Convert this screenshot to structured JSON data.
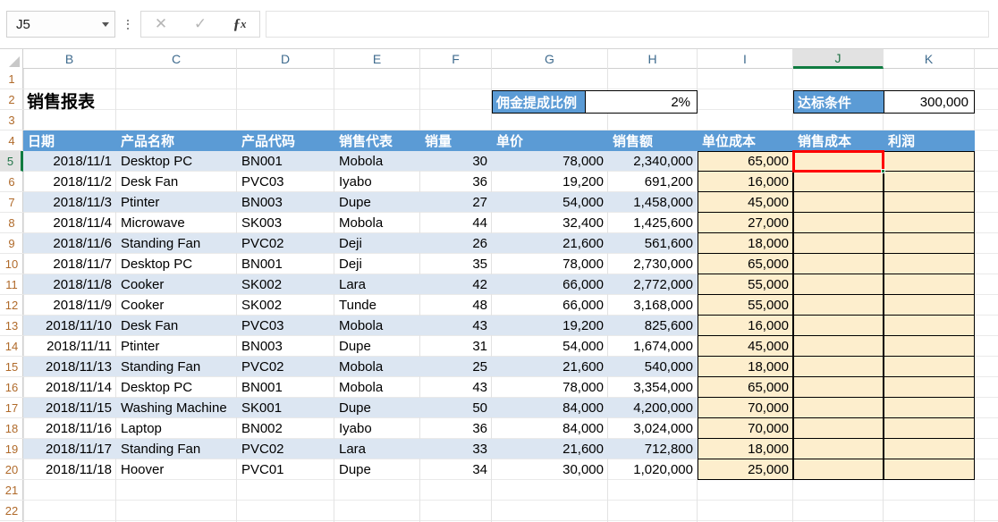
{
  "formula_bar": {
    "name_box_value": "J5",
    "formula_value": "",
    "cancel_icon": "close-x-icon",
    "confirm_icon": "checkmark-icon",
    "function_icon": "fx-insert-function-icon",
    "dropdown_icon": "chevron-down-icon",
    "overflow_icon": "vertical-dots-icon"
  },
  "grid": {
    "columns": [
      "B",
      "C",
      "D",
      "E",
      "F",
      "G",
      "H",
      "I",
      "J",
      "K"
    ],
    "active_column": "J",
    "active_row": "5",
    "rows": [
      "1",
      "2",
      "3",
      "4",
      "5",
      "6",
      "7",
      "8",
      "9",
      "10",
      "11",
      "12",
      "13",
      "14",
      "15",
      "16",
      "17",
      "18",
      "19",
      "20",
      "21",
      "22"
    ]
  },
  "sheet": {
    "title": "销售报表",
    "commission": {
      "label": "佣金提成比例",
      "value": "2%"
    },
    "target": {
      "label": "达标条件",
      "value": "300,000"
    },
    "headers": [
      "日期",
      "产品名称",
      "产品代码",
      "销售代表",
      "销量",
      "单价",
      "销售额",
      "单位成本",
      "销售成本",
      "利润"
    ],
    "rows": [
      {
        "date": "2018/11/1",
        "product": "Desktop PC",
        "code": "BN001",
        "rep": "Mobola",
        "qty": "30",
        "price": "78,000",
        "sales": "2,340,000",
        "unit_cost": "65,000",
        "sales_cost": "",
        "profit": ""
      },
      {
        "date": "2018/11/2",
        "product": "Desk Fan",
        "code": "PVC03",
        "rep": "Iyabo",
        "qty": "36",
        "price": "19,200",
        "sales": "691,200",
        "unit_cost": "16,000",
        "sales_cost": "",
        "profit": ""
      },
      {
        "date": "2018/11/3",
        "product": "Ptinter",
        "code": "BN003",
        "rep": "Dupe",
        "qty": "27",
        "price": "54,000",
        "sales": "1,458,000",
        "unit_cost": "45,000",
        "sales_cost": "",
        "profit": ""
      },
      {
        "date": "2018/11/4",
        "product": "Microwave",
        "code": "SK003",
        "rep": "Mobola",
        "qty": "44",
        "price": "32,400",
        "sales": "1,425,600",
        "unit_cost": "27,000",
        "sales_cost": "",
        "profit": ""
      },
      {
        "date": "2018/11/6",
        "product": "Standing Fan",
        "code": "PVC02",
        "rep": "Deji",
        "qty": "26",
        "price": "21,600",
        "sales": "561,600",
        "unit_cost": "18,000",
        "sales_cost": "",
        "profit": ""
      },
      {
        "date": "2018/11/7",
        "product": "Desktop PC",
        "code": "BN001",
        "rep": "Deji",
        "qty": "35",
        "price": "78,000",
        "sales": "2,730,000",
        "unit_cost": "65,000",
        "sales_cost": "",
        "profit": ""
      },
      {
        "date": "2018/11/8",
        "product": "Cooker",
        "code": "SK002",
        "rep": "Lara",
        "qty": "42",
        "price": "66,000",
        "sales": "2,772,000",
        "unit_cost": "55,000",
        "sales_cost": "",
        "profit": ""
      },
      {
        "date": "2018/11/9",
        "product": "Cooker",
        "code": "SK002",
        "rep": "Tunde",
        "qty": "48",
        "price": "66,000",
        "sales": "3,168,000",
        "unit_cost": "55,000",
        "sales_cost": "",
        "profit": ""
      },
      {
        "date": "2018/11/10",
        "product": "Desk Fan",
        "code": "PVC03",
        "rep": "Mobola",
        "qty": "43",
        "price": "19,200",
        "sales": "825,600",
        "unit_cost": "16,000",
        "sales_cost": "",
        "profit": ""
      },
      {
        "date": "2018/11/11",
        "product": "Ptinter",
        "code": "BN003",
        "rep": "Dupe",
        "qty": "31",
        "price": "54,000",
        "sales": "1,674,000",
        "unit_cost": "45,000",
        "sales_cost": "",
        "profit": ""
      },
      {
        "date": "2018/11/13",
        "product": "Standing Fan",
        "code": "PVC02",
        "rep": "Mobola",
        "qty": "25",
        "price": "21,600",
        "sales": "540,000",
        "unit_cost": "18,000",
        "sales_cost": "",
        "profit": ""
      },
      {
        "date": "2018/11/14",
        "product": "Desktop PC",
        "code": "BN001",
        "rep": "Mobola",
        "qty": "43",
        "price": "78,000",
        "sales": "3,354,000",
        "unit_cost": "65,000",
        "sales_cost": "",
        "profit": ""
      },
      {
        "date": "2018/11/15",
        "product": "Washing Machine",
        "code": "SK001",
        "rep": "Dupe",
        "qty": "50",
        "price": "84,000",
        "sales": "4,200,000",
        "unit_cost": "70,000",
        "sales_cost": "",
        "profit": ""
      },
      {
        "date": "2018/11/16",
        "product": "Laptop",
        "code": "BN002",
        "rep": "Iyabo",
        "qty": "36",
        "price": "84,000",
        "sales": "3,024,000",
        "unit_cost": "70,000",
        "sales_cost": "",
        "profit": ""
      },
      {
        "date": "2018/11/17",
        "product": "Standing Fan",
        "code": "PVC02",
        "rep": "Lara",
        "qty": "33",
        "price": "21,600",
        "sales": "712,800",
        "unit_cost": "18,000",
        "sales_cost": "",
        "profit": ""
      },
      {
        "date": "2018/11/18",
        "product": "Hoover",
        "code": "PVC01",
        "rep": "Dupe",
        "qty": "34",
        "price": "30,000",
        "sales": "1,020,000",
        "unit_cost": "25,000",
        "sales_cost": "",
        "profit": ""
      }
    ]
  },
  "colors": {
    "header_blue": "#5b9bd5",
    "band_blue": "#dce6f2",
    "cream": "#fdeecd",
    "selection_red": "#ff0000",
    "excel_green": "#107c41"
  }
}
